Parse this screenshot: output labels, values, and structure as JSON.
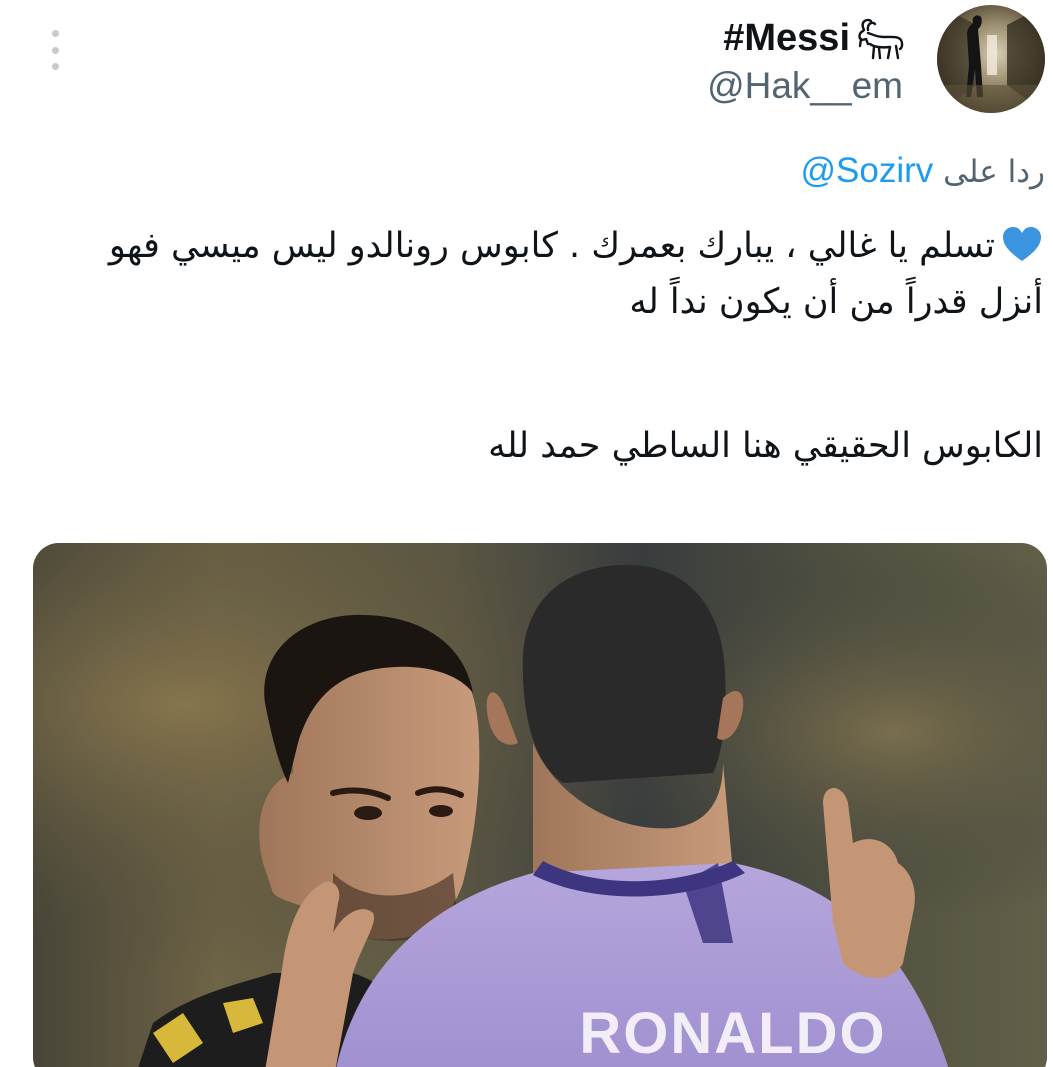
{
  "author": {
    "display_name": "#Messi",
    "handle": "@Hak__em",
    "badge_icon": "goat-icon",
    "avatar_icon": "avatar-image"
  },
  "menu": {
    "icon": "more-vertical-icon"
  },
  "reply": {
    "prefix": "ردا على",
    "mention": "@Sozirv"
  },
  "body": {
    "heart_icon": "blue-heart-icon",
    "line1": "تسلم يا غالي ، يبارك بعمرك . كابوس رونالدو ليس ميسي فهو أنزل قدراً من أن يكون نداً له",
    "line2": "الكابوس الحقيقي هنا الساطي حمد لله"
  },
  "media": {
    "jersey_text": "RONALDO"
  },
  "colors": {
    "text": "#0f1419",
    "secondary": "#536471",
    "link": "#1d9bf0",
    "heart": "#3b94e0"
  }
}
